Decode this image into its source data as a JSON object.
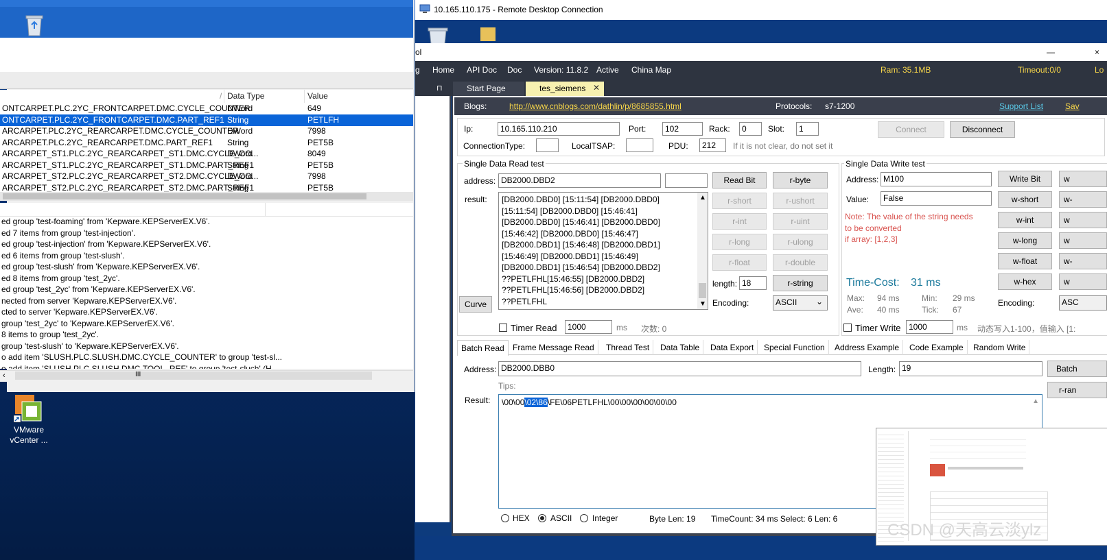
{
  "left_window": {
    "columns": [
      "",
      "Data Type",
      "Value"
    ],
    "rows": [
      {
        "name": "ONTCARPET.PLC.2YC_FRONTCARPET.DMC.CYCLE_COUNTER",
        "type": "DWord",
        "value": "649",
        "selected": false
      },
      {
        "name": "ONTCARPET.PLC.2YC_FRONTCARPET.DMC.PART_REF1",
        "type": "String",
        "value": "PETLFH",
        "selected": true
      },
      {
        "name": "ARCARPET.PLC.2YC_REARCARPET.DMC.CYCLE_COUNTER",
        "type": "DWord",
        "value": "7998",
        "selected": false
      },
      {
        "name": "ARCARPET.PLC.2YC_REARCARPET.DMC.PART_REF1",
        "type": "String",
        "value": "PET5B",
        "selected": false
      },
      {
        "name": "ARCARPET_ST1.PLC.2YC_REARCARPET_ST1.DMC.CYCLE_CO...",
        "type": "DWord",
        "value": "8049",
        "selected": false
      },
      {
        "name": "ARCARPET_ST1.PLC.2YC_REARCARPET_ST1.DMC.PART_REF1",
        "type": "String",
        "value": "PET5B",
        "selected": false
      },
      {
        "name": "ARCARPET_ST2.PLC.2YC_REARCARPET_ST2.DMC.CYCLE_CO...",
        "type": "DWord",
        "value": "7998",
        "selected": false
      },
      {
        "name": "ARCARPET_ST2.PLC.2YC_REARCARPET_ST2.DMC.PART_REF1",
        "type": "String",
        "value": "PET5B",
        "selected": false
      }
    ],
    "log": [
      "ed group 'test-foaming' from 'Kepware.KEPServerEX.V6'.",
      "ed 7 items from group 'test-injection'.",
      "ed group 'test-injection' from 'Kepware.KEPServerEX.V6'.",
      "ed 6 items from group 'test-slush'.",
      "ed group 'test-slush' from 'Kepware.KEPServerEX.V6'.",
      "ed 8 items from group 'test_2yc'.",
      "ed group 'test_2yc' from 'Kepware.KEPServerEX.V6'.",
      "nected from server 'Kepware.KEPServerEX.V6'.",
      "cted to server 'Kepware.KEPServerEX.V6'.",
      "group 'test_2yc' to 'Kepware.KEPServerEX.V6'.",
      "8 items to group 'test_2yc'.",
      "group 'test-slush' to 'Kepware.KEPServerEX.V6'.",
      "o add item 'SLUSH.PLC.SLUSH.DMC.CYCLE_COUNTER' to group 'test-sl...",
      "o add item 'SLUSH.PLC.SLUSH.DMC.TOOL_REF' to group 'test-slush' (H..."
    ],
    "scroll_glyph": "III"
  },
  "desktop": {
    "vm_label_1": "VMware",
    "vm_label_2": "vCenter ..."
  },
  "rdc": {
    "title": "10.165.110.175 - Remote Desktop Connection"
  },
  "app": {
    "title_fragment": "ol",
    "minimize": "—",
    "close_fragment": "×",
    "menu": [
      "g",
      "Home",
      "API Doc",
      "Doc",
      "Version: 11.8.2",
      "Active",
      "China Map"
    ],
    "ram": "Ram: 35.1MB",
    "timeout": "Timeout:0/0",
    "timeout_cut": "Lo",
    "tabs": {
      "start": "Start Page",
      "active": "tes_siemens",
      "close": "✕",
      "pin": "⊓"
    },
    "blogs_label": "Blogs:",
    "blogs_url": "http://www.cnblogs.com/dathlin/p/8685855.html",
    "protocols_label": "Protocols:",
    "protocols_value": "s7-1200",
    "support": "Support List",
    "save_cut": "Sav"
  },
  "conn": {
    "ip_label": "Ip:",
    "ip": "10.165.110.210",
    "port_label": "Port:",
    "port": "102",
    "rack_label": "Rack:",
    "rack": "0",
    "slot_label": "Slot:",
    "slot": "1",
    "connect": "Connect",
    "disconnect": "Disconnect",
    "conntype_label": "ConnectionType:",
    "conntype": "",
    "tsap_label": "LocalTSAP:",
    "tsap": "",
    "pdu_label": "PDU:",
    "pdu": "212",
    "hint": "If it is not clear, do not set it"
  },
  "read": {
    "group_title": "Single Data Read test",
    "address_label": "address:",
    "address": "DB2000.DBD2",
    "extra": "",
    "result_label": "result:",
    "result_lines": [
      "[DB2000.DBD0] [15:11:54] [DB2000.DBD0]",
      "[15:11:54] [DB2000.DBD0] [15:46:41]",
      "[DB2000.DBD0] [15:46:41] [DB2000.DBD0]",
      "[15:46:42] [DB2000.DBD0] [15:46:47]",
      "[DB2000.DBD1] [15:46:48] [DB2000.DBD1]",
      "[15:46:49] [DB2000.DBD1] [15:46:49]",
      "[DB2000.DBD1] [15:46:54] [DB2000.DBD2]",
      " ??\u0002PETLFHL[15:46:55] [DB2000.DBD2]",
      " ??\u0002PETLFHL[15:46:56] [DB2000.DBD2]",
      " ??\u0002PETLFHL"
    ],
    "curve": "Curve",
    "buttons": [
      "Read Bit",
      "r-byte",
      "r-short",
      "r-ushort",
      "r-int",
      "r-uint",
      "r-long",
      "r-ulong",
      "r-float",
      "r-double"
    ],
    "length_label": "length:",
    "length": "18",
    "rstring": "r-string",
    "encoding_label": "Encoding:",
    "encoding": "ASCII",
    "timer_label": "Timer Read",
    "timer": "1000",
    "ms": "ms",
    "count": "次数: 0"
  },
  "write": {
    "group_title": "Single Data Write test",
    "address_label": "Address:",
    "address": "M100",
    "value_label": "Value:",
    "value": "False",
    "note1": "Note: The value of the string needs",
    "note2": "to be converted",
    "note3": "if array: [1,2,3]",
    "buttons": [
      "Write Bit",
      "w-short",
      "w-int",
      "w-long",
      "w-float",
      "w-hex"
    ],
    "buttons_cut": [
      "w",
      "w-",
      "w",
      "w",
      "w-",
      "w"
    ],
    "timecost_label": "Time-Cost:",
    "timecost": "31 ms",
    "max_label": "Max:",
    "max": "94 ms",
    "min_label": "Min:",
    "min": "29 ms",
    "ave_label": "Ave:",
    "ave": "40 ms",
    "tick_label": "Tick:",
    "tick": "67",
    "encoding_label": "Encoding:",
    "encoding_cut": "ASC",
    "timer_label": "Timer Write",
    "timer": "1000",
    "ms": "ms",
    "note_cn": "动态写入1-100，值输入 [1:"
  },
  "batch": {
    "tabs": [
      "Batch Read",
      "Frame Message Read",
      "Thread Test",
      "Data Table",
      "Data Export",
      "Special Function",
      "Address Example",
      "Code Example",
      "Random Write"
    ],
    "address_label": "Address:",
    "address": "DB2000.DBB0",
    "length_label": "Length:",
    "length": "19",
    "batch_btn": "Batch",
    "rrand_btn": "r-ran",
    "tips": "Tips:",
    "result_label": "Result:",
    "result_pre": "\\00\\00",
    "result_sel": "\\02\\86",
    "result_post": "\\FE\\06PETLFHL\\00\\00\\00\\00\\00\\00",
    "radio_hex": "HEX",
    "radio_ascii": "ASCII",
    "radio_int": "Integer",
    "bytelen": "Byte Len: 19",
    "timecount": "TimeCount: 34 ms Select: 6 Len: 6"
  },
  "watermark": "CSDN @天高云淡ylz"
}
